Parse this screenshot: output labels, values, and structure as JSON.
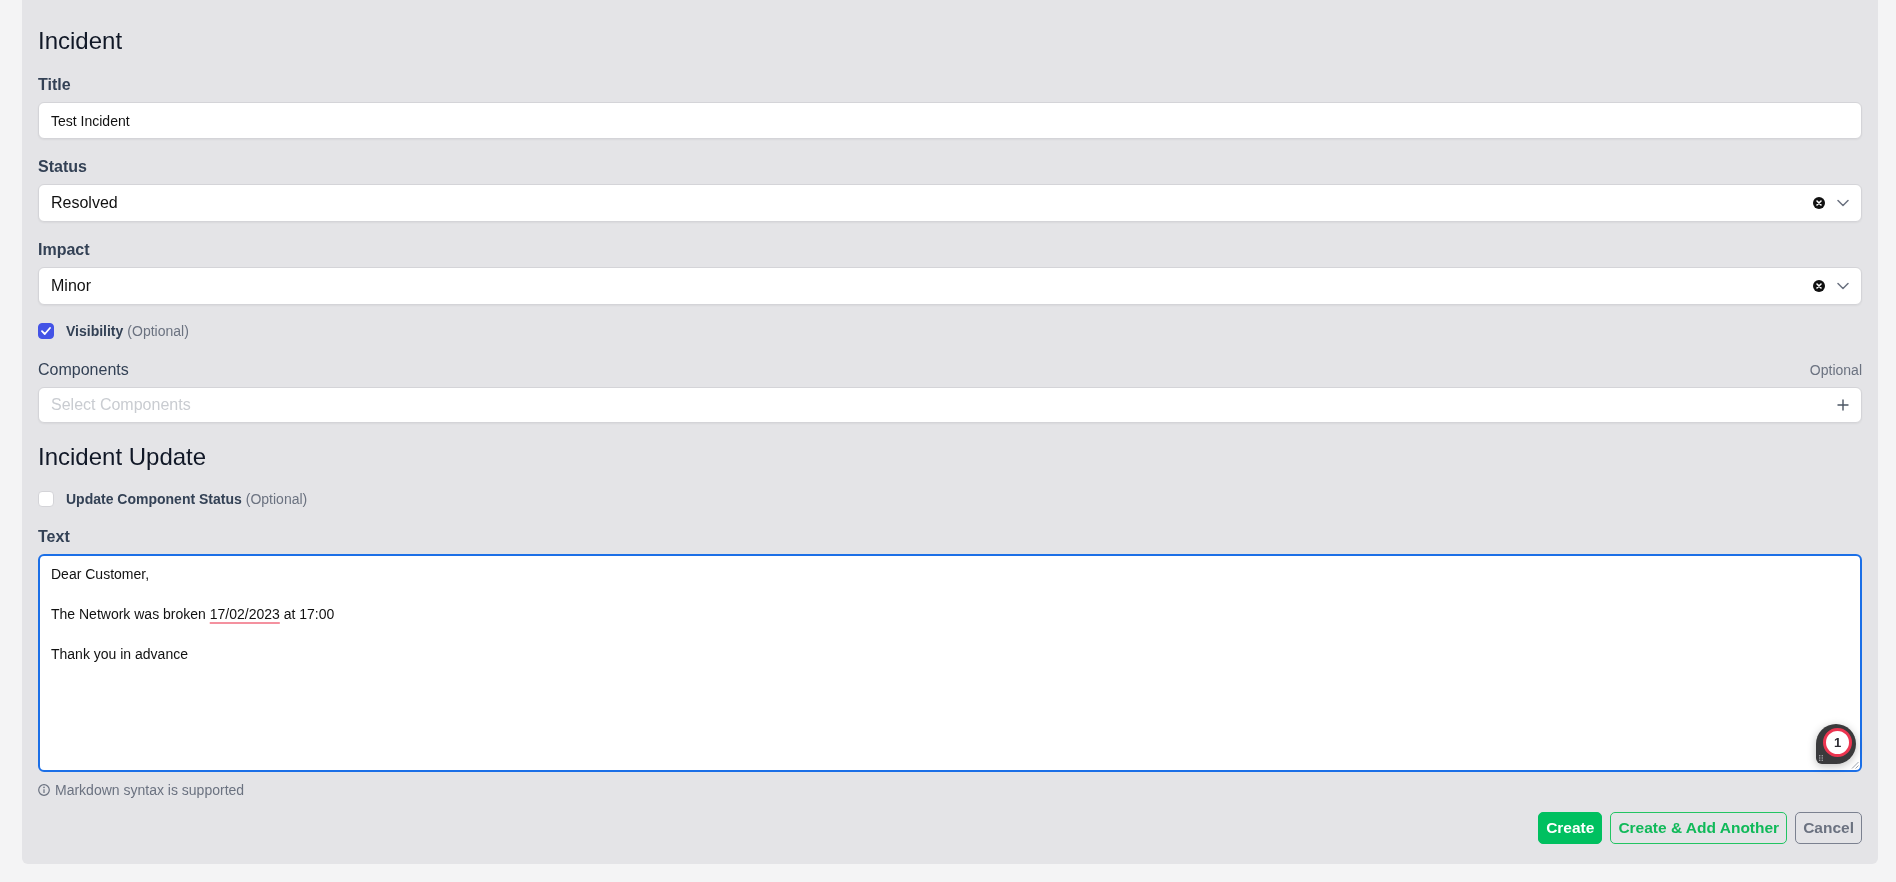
{
  "sections": [
    {
      "heading": "Incident",
      "fields": [
        {
          "kind": "text",
          "label": "Title",
          "value": "Test Incident"
        },
        {
          "kind": "select",
          "label": "Status",
          "value": "Resolved"
        },
        {
          "kind": "select",
          "label": "Impact",
          "value": "Minor"
        },
        {
          "kind": "checkbox",
          "label": "Visibility",
          "hint": "(Optional)",
          "checked": true
        },
        {
          "kind": "multiselect",
          "label": "Components",
          "hint": "Optional",
          "placeholder": "Select Components"
        }
      ]
    },
    {
      "heading": "Incident Update",
      "fields": [
        {
          "kind": "checkbox",
          "label": "Update Component Status",
          "hint": "(Optional)",
          "checked": false
        },
        {
          "kind": "textarea",
          "label": "Text",
          "focused": true,
          "segments": [
            {
              "text": "Dear Customer,\n\nThe Network was broken ",
              "misspelled": false
            },
            {
              "text": "17/02/2023",
              "misspelled": true
            },
            {
              "text": " at 17:00\n\nThank you in advance",
              "misspelled": false
            }
          ],
          "badge": "1",
          "note": "Markdown syntax is supported"
        }
      ]
    }
  ],
  "buttons": [
    {
      "kind": "primary",
      "label": "Create"
    },
    {
      "kind": "outline",
      "label": "Create & Add Another"
    },
    {
      "kind": "secondary",
      "label": "Cancel"
    }
  ]
}
